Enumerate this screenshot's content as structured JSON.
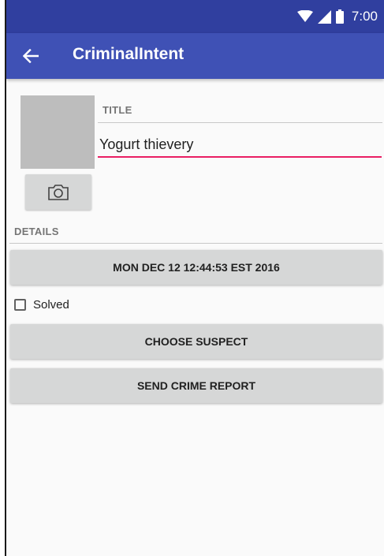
{
  "status_bar": {
    "time": "7:00",
    "icons": [
      "wifi-icon",
      "signal-icon",
      "battery-icon"
    ]
  },
  "app_bar": {
    "title": "CriminalIntent",
    "back_icon": "arrow-back-icon"
  },
  "crime": {
    "title_label": "TITLE",
    "title_value": "Yogurt thievery",
    "details_label": "DETAILS",
    "date_button": "MON DEC 12 12:44:53 EST 2016",
    "solved_label": "Solved",
    "solved_checked": false,
    "choose_suspect_button": "CHOOSE SUSPECT",
    "send_report_button": "SEND CRIME REPORT",
    "camera_icon": "camera-icon"
  },
  "colors": {
    "status_bar": "#303f9f",
    "app_bar": "#3f51b5",
    "accent": "#e91e63",
    "button": "#d6d7d7",
    "photo_placeholder": "#bdbdbd"
  }
}
